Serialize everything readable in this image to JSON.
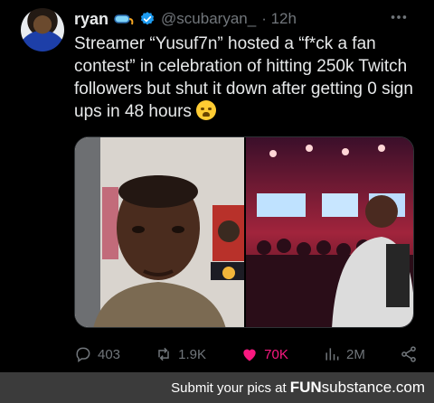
{
  "tweet": {
    "display_name": "ryan",
    "handle": "@scubaryan_",
    "time": "· 12h",
    "more_icon": "more-icon",
    "text": "Streamer “Yusuf7n” hosted a “f*ck a fan contest” in celebration of hitting 250k Twitch followers but shut it down after getting 0 sign ups in 48 hours",
    "emoji": "loudly-crying-face-emoji"
  },
  "metrics": {
    "replies": "403",
    "retweets": "1.9K",
    "likes": "70K",
    "views": "2M"
  },
  "colors": {
    "background": "#000000",
    "text": "#e7e9ea",
    "muted": "#71767b",
    "like": "#f91880",
    "verified": "#1d9bf0",
    "footer": "#3b3b3b"
  },
  "footer": {
    "caption": "Submit your pics at",
    "brand_fun": "FUN",
    "brand_substance": "substance",
    "brand_domain": ".com"
  }
}
